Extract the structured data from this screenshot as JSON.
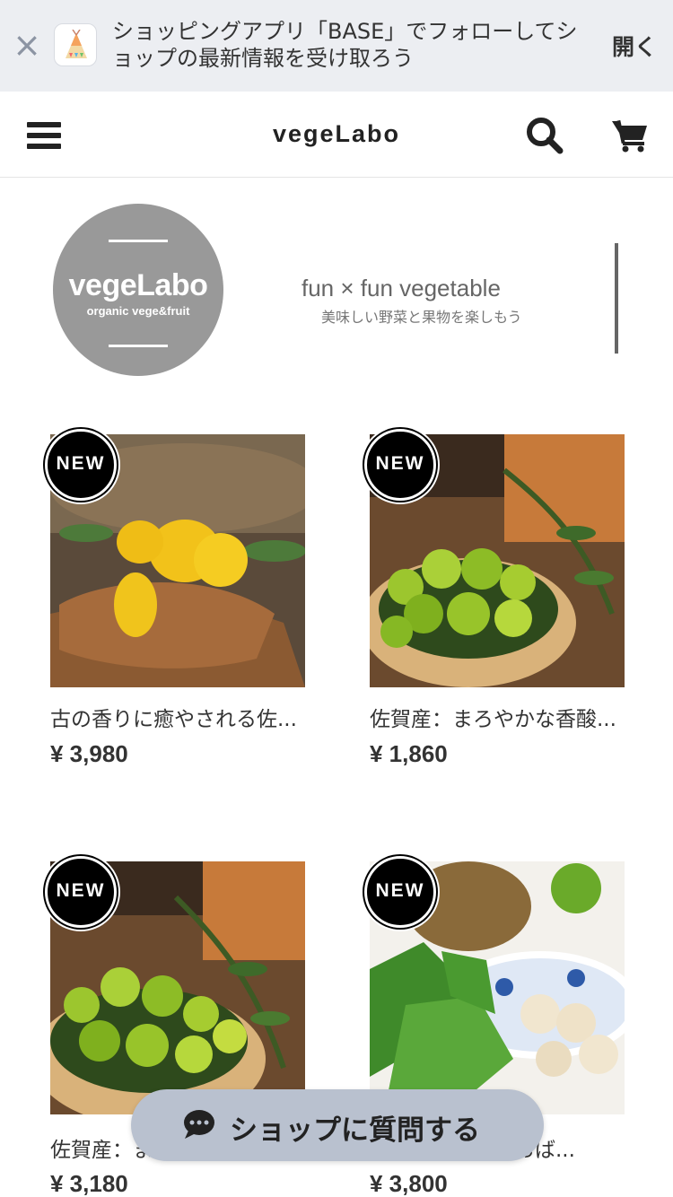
{
  "banner": {
    "close_symbol": "×",
    "app_icon": "base-teepee-icon",
    "message": "ショッピングアプリ「BASE」でフォローしてショップの最新情報を受け取ろう",
    "open_label": "開く"
  },
  "header": {
    "shop_name": "vegeLabo",
    "icons": [
      "menu-icon",
      "search-icon",
      "cart-icon"
    ]
  },
  "shop_logo": {
    "name": "vegeLabo",
    "sub": "organic vege&fruit",
    "tagline_en": "fun × fun  vegetable",
    "tagline_jp": "美味しい野菜と果物を楽しもう"
  },
  "products": [
    {
      "badge": "NEW",
      "name": "古の香りに癒やされる佐...",
      "price": "¥ 3,980"
    },
    {
      "badge": "NEW",
      "name": "佐賀産：まろやかな香酸...",
      "price": "¥ 1,860"
    },
    {
      "badge": "NEW",
      "name": "佐賀産：まろやかな香酸...",
      "price": "¥ 3,180"
    },
    {
      "badge": "NEW",
      "name": "〇〇〇〇〇大保おば...",
      "price": "¥ 3,800"
    }
  ],
  "question_button": {
    "label": "ショップに質問する",
    "icon": "chat-bubble-icon"
  },
  "colors": {
    "banner_bg": "#eceef2",
    "logo_gray": "#999999",
    "question_bg": "#b9c1cf",
    "badge_black": "#000000"
  }
}
